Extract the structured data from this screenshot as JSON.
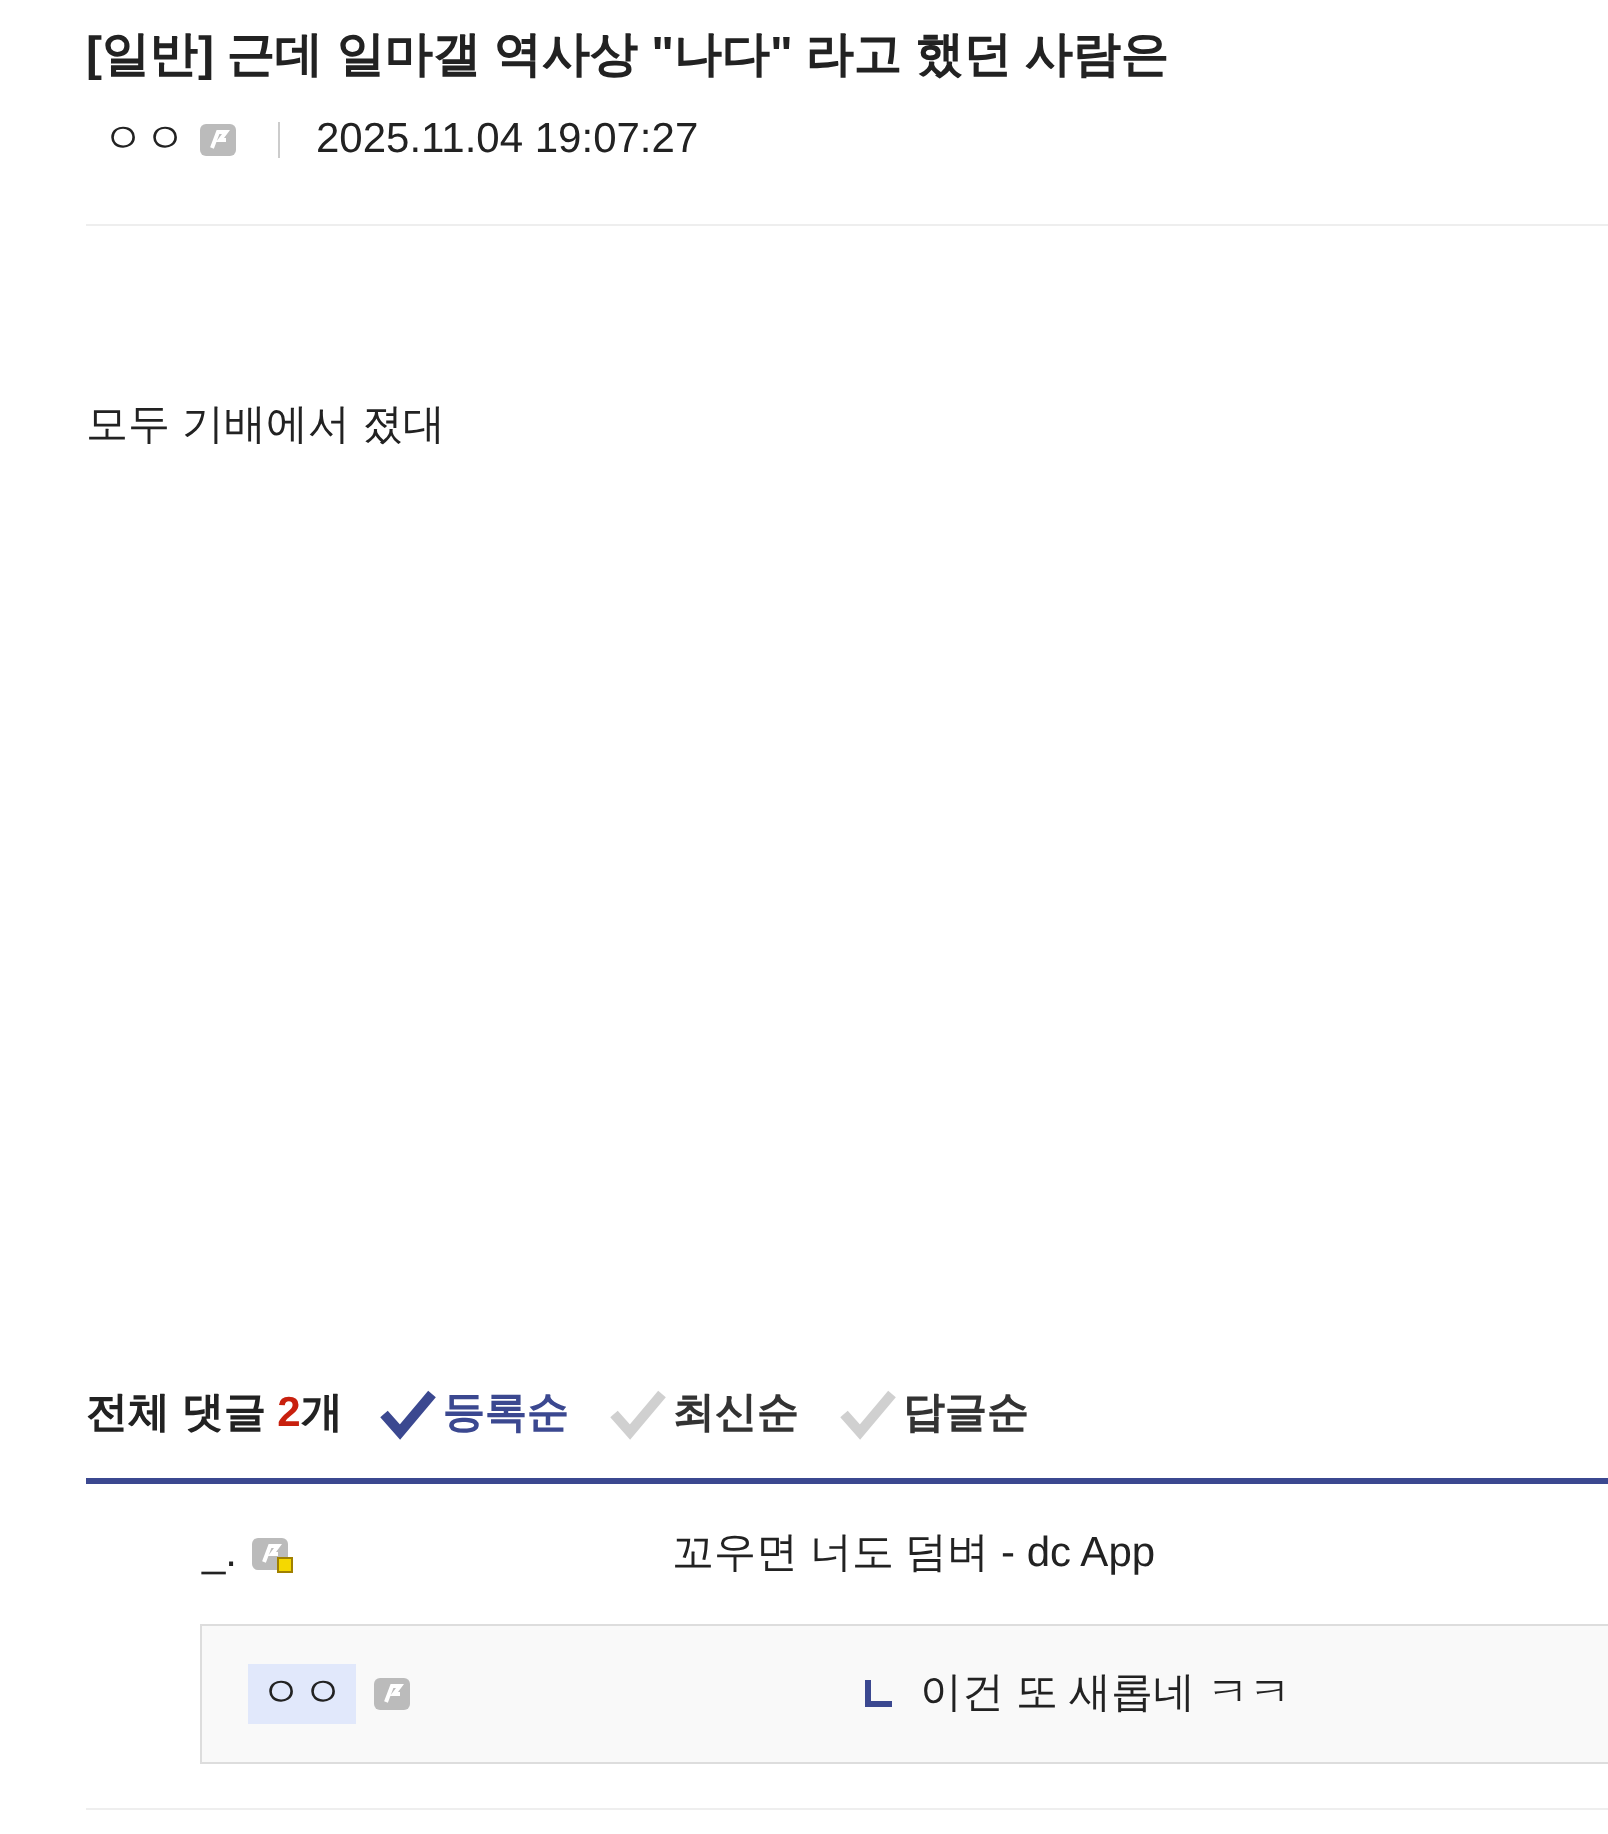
{
  "post": {
    "title": "[일반] 근데 일마갤 역사상 \"나다\" 라고 했던 사람은",
    "author": "ㅇㅇ",
    "date": "2025.11.04 19:07:27",
    "body": "모두 기배에서 졌대"
  },
  "comments_header": {
    "label": "전체 댓글",
    "count": "2",
    "unit": "개"
  },
  "sort_options": [
    {
      "label": "등록순",
      "selected": true
    },
    {
      "label": "최신순",
      "selected": false
    },
    {
      "label": "답글순",
      "selected": false
    }
  ],
  "comments": [
    {
      "kind": "comment",
      "author": "_.",
      "author_highlighted": false,
      "badge_marked": true,
      "text": "꼬우면 너도 덤벼 - dc App"
    },
    {
      "kind": "reply",
      "author": "ㅇㅇ",
      "author_highlighted": true,
      "badge_marked": false,
      "text": "이건 또 새롭네 ㅋㅋ"
    }
  ]
}
